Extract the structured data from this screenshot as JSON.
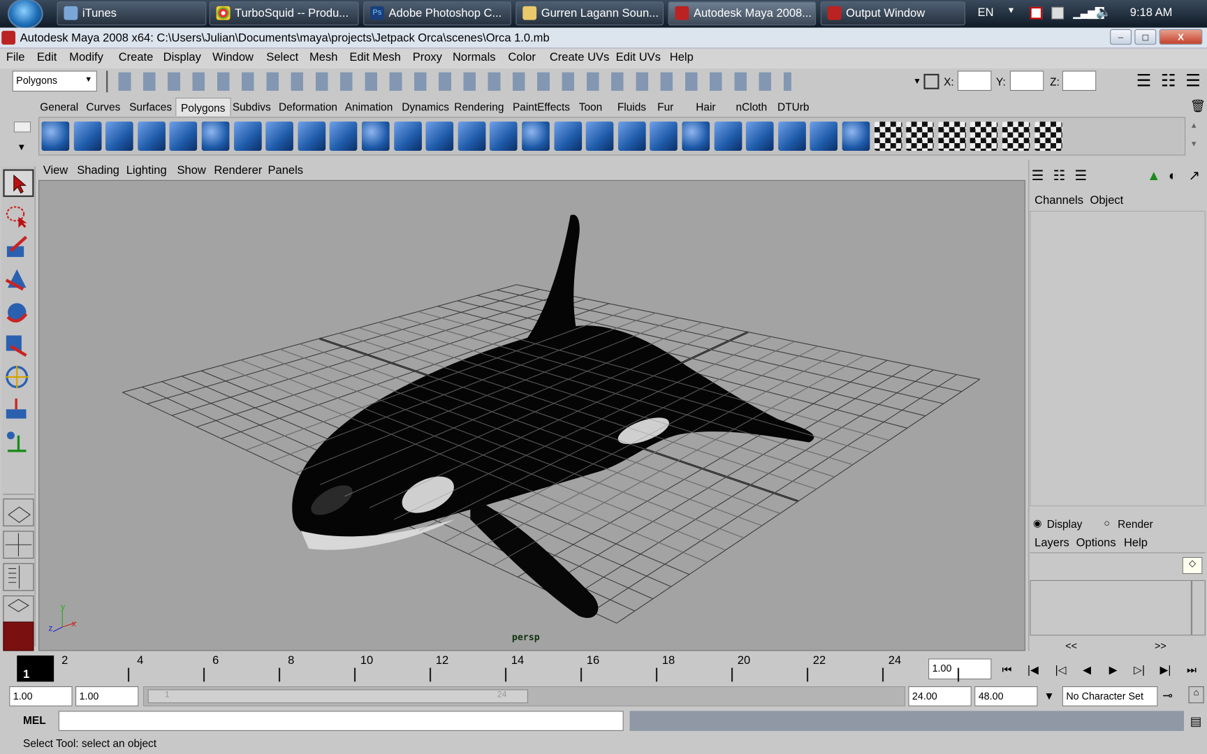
{
  "taskbar": {
    "tasks": [
      {
        "label": "iTunes"
      },
      {
        "label": "TurboSquid -- Produ..."
      },
      {
        "label": "Adobe Photoshop C..."
      },
      {
        "label": "Gurren Lagann Soun..."
      },
      {
        "label": "Autodesk Maya 2008..."
      },
      {
        "label": "Output Window"
      }
    ],
    "lang": "EN",
    "clock": "9:18 AM"
  },
  "window": {
    "title": "Autodesk Maya 2008 x64: C:\\Users\\Julian\\Documents\\maya\\projects\\Jetpack Orca\\scenes\\Orca 1.0.mb",
    "min": "–",
    "max": "◻",
    "close": "X"
  },
  "menu": [
    "File",
    "Edit",
    "Modify",
    "Create",
    "Display",
    "Window",
    "Select",
    "Mesh",
    "Edit Mesh",
    "Proxy",
    "Normals",
    "Color",
    "Create UVs",
    "Edit UVs",
    "Help"
  ],
  "statusline": {
    "mode": "Polygons",
    "x_label": "X:",
    "y_label": "Y:",
    "z_label": "Z:"
  },
  "shelf_tabs": [
    "General",
    "Curves",
    "Surfaces",
    "Polygons",
    "Subdivs",
    "Deformation",
    "Animation",
    "Dynamics",
    "Rendering",
    "PaintEffects",
    "Toon",
    "Fluids",
    "Fur",
    "Hair",
    "nCloth",
    "DTUrb"
  ],
  "panel_menu": [
    "View",
    "Shading",
    "Lighting",
    "Show",
    "Renderer",
    "Panels"
  ],
  "viewport": {
    "camera": "persp",
    "axis_x": "x",
    "axis_y": "y",
    "axis_z": "z"
  },
  "channelbox": {
    "tabs": [
      "Channels",
      "Object"
    ]
  },
  "layers": {
    "display": "Display",
    "render": "Render",
    "menu": [
      "Layers",
      "Options",
      "Help"
    ],
    "prev": "<<",
    "next": ">>"
  },
  "timeline": {
    "ticks": [
      "2",
      "4",
      "6",
      "8",
      "10",
      "12",
      "14",
      "16",
      "18",
      "20",
      "22",
      "24"
    ],
    "current_frame": "1",
    "current_time": "1.00"
  },
  "range": {
    "start": "1.00",
    "playback_start": "1.00",
    "playback_end": "24.00",
    "end": "48.00",
    "slider_start": "1",
    "slider_end": "24",
    "character_set": "No Character Set"
  },
  "command": {
    "label": "MEL"
  },
  "helpline": "Select Tool: select an object",
  "colors": {
    "viewport": "#a3a3a3",
    "ui": "#c8c8c8",
    "shelf_icon": "#1e5aa8"
  }
}
